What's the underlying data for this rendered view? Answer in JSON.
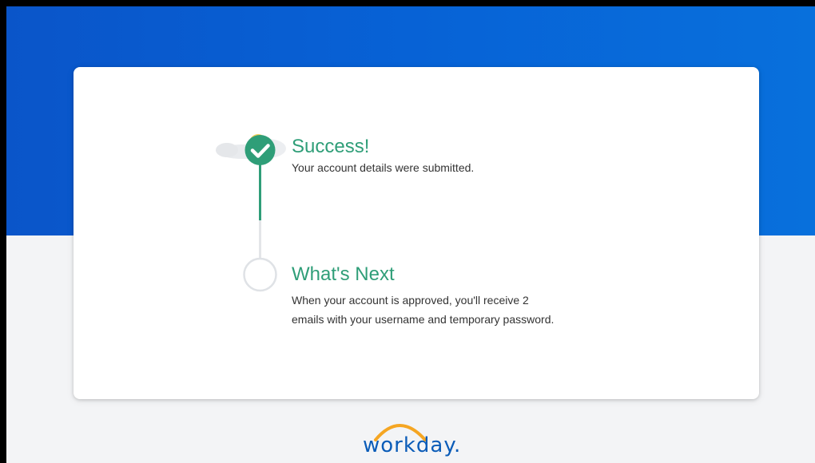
{
  "colors": {
    "banner_blue": "#0762d6",
    "success_green": "#2f9e78",
    "logo_blue": "#0b5cb8",
    "logo_orange": "#f5a623"
  },
  "steps": [
    {
      "title": "Success!",
      "description_lines": [
        "Your account details were submitted."
      ],
      "status": "complete",
      "icon": "check-circle-icon"
    },
    {
      "title": "What's Next",
      "description_lines": [
        "When your account is approved, you'll receive 2",
        "emails with your username and temporary password."
      ],
      "status": "pending",
      "icon": "empty-circle-icon"
    }
  ],
  "footer": {
    "logo_text": "workday."
  }
}
